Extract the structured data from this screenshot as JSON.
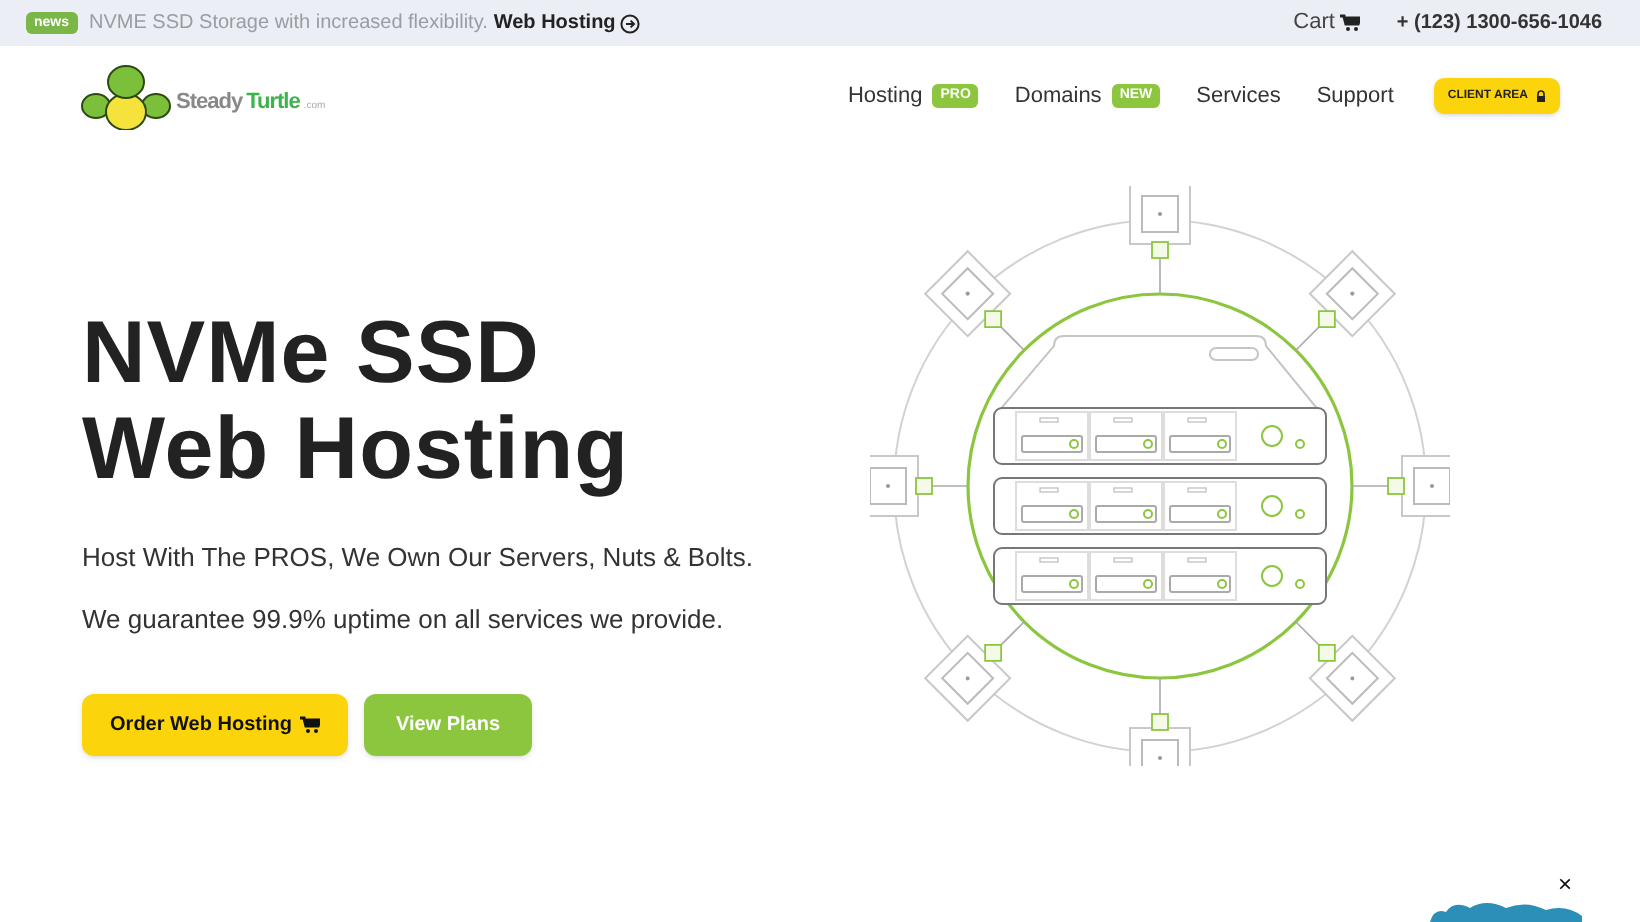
{
  "topbar": {
    "badge": "news",
    "message": "NVME SSD Storage with increased flexibility.",
    "link": "Web Hosting",
    "cart": "Cart",
    "phone": "+ (123) 1300-656-1046"
  },
  "logo": {
    "part_1": "Steady",
    "part_2": "Turtle",
    "suffix": ".com"
  },
  "nav": [
    {
      "label": "Hosting",
      "badge": "PRO"
    },
    {
      "label": "Domains",
      "badge": "NEW"
    },
    {
      "label": "Services"
    },
    {
      "label": "Support"
    }
  ],
  "client_button": "CLIENT AREA",
  "hero": {
    "title_lines": [
      "NVMe SSD",
      "Web Hosting"
    ],
    "text": "Host With The PROS, We Own Our Servers, Nuts & Bolts. We guarantee 99.9% uptime on all services we provide.",
    "buttons": [
      {
        "label": "Order Web Hosting",
        "kind": "primary"
      },
      {
        "label": "View Plans",
        "kind": "secondary"
      }
    ]
  },
  "chat_close": "×"
}
